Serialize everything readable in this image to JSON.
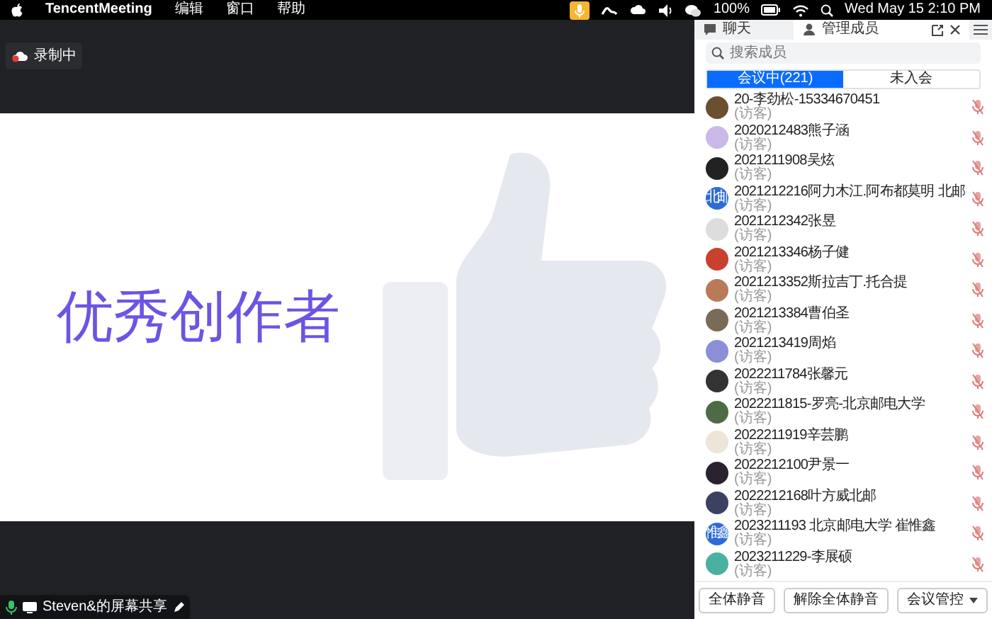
{
  "menu_bar": {
    "app_name": "TencentMeeting",
    "menus": [
      "编辑",
      "窗口",
      "帮助"
    ],
    "battery": "100%",
    "clock": "Wed May 15  2:10 PM"
  },
  "recording": {
    "label": "录制中"
  },
  "shared_slide": {
    "title": "优秀创作者"
  },
  "share_label": "Steven&的屏幕共享",
  "panel": {
    "tabs": [
      {
        "label": "聊天",
        "selected": false
      },
      {
        "label": "管理成员",
        "selected": true
      }
    ],
    "search": {
      "placeholder": "搜索成员"
    },
    "segments": [
      {
        "label": "会议中(221)",
        "selected": true
      },
      {
        "label": "未入会",
        "selected": false
      }
    ],
    "members": [
      {
        "name": "20-李劲松-15334670451",
        "role": "(访客)",
        "muted": true
      },
      {
        "name": "2020212483熊子涵",
        "role": "(访客)",
        "muted": true
      },
      {
        "name": "2021211908吴炫",
        "role": "(访客)",
        "muted": true
      },
      {
        "name": "2021212216阿力木江.阿布都莫明 北邮",
        "role": "(访客)",
        "muted": true,
        "avatar_text": "北邮"
      },
      {
        "name": "2021212342张昱",
        "role": "(访客)",
        "muted": true
      },
      {
        "name": "2021213346杨子健",
        "role": "(访客)",
        "muted": true
      },
      {
        "name": "2021213352斯拉吉丁.托合提",
        "role": "(访客)",
        "muted": true
      },
      {
        "name": "2021213384曹伯圣",
        "role": "(访客)",
        "muted": true
      },
      {
        "name": "2021213419周焰",
        "role": "(访客)",
        "muted": true
      },
      {
        "name": "2022211784张馨元",
        "role": "(访客)",
        "muted": true
      },
      {
        "name": "2022211815-罗亮-北京邮电大学",
        "role": "(访客)",
        "muted": true
      },
      {
        "name": "2022211919辛芸鹏",
        "role": "(访客)",
        "muted": true
      },
      {
        "name": "2022212100尹景一",
        "role": "(访客)",
        "muted": true
      },
      {
        "name": "2022212168叶方威北邮",
        "role": "(访客)",
        "muted": true
      },
      {
        "name": "2023211193 北京邮电大学 崔惟鑫",
        "role": "(访客)",
        "muted": true,
        "avatar_text": "惟鑫"
      },
      {
        "name": "2023211229-李展硕",
        "role": "(访客)",
        "muted": true
      }
    ],
    "buttons": [
      {
        "label": "全体静音",
        "kind": "plain"
      },
      {
        "label": "解除全体静音",
        "kind": "plain"
      },
      {
        "label": "会议管控",
        "kind": "dropdown"
      }
    ]
  }
}
